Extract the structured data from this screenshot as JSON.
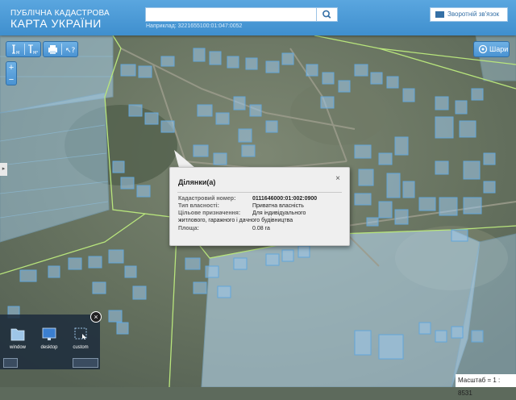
{
  "header": {
    "title_line1": "ПУБЛІЧНА КАДАСТРОВА",
    "title_line2": "КАРТА УКРАЇНИ",
    "search_placeholder": "",
    "search_hint": "Наприклад: 3221655100:01:047:0052",
    "feedback_label": "Зворотній зв'язок"
  },
  "toolbar": {
    "left_tools": [
      "measure-length",
      "measure-area",
      "print",
      "help"
    ],
    "zoom_in": "+",
    "zoom_out": "−",
    "layers_label": "Шари"
  },
  "popup": {
    "title": "Ділянки(а)",
    "close": "×",
    "rows": [
      {
        "label": "Кадастровий номер:",
        "value": "0111646000:01:002:0900"
      },
      {
        "label": "Тип власності:",
        "value": "Приватна власність"
      },
      {
        "label": "Цільове призначення:",
        "value": "Для індивідуального житлового, гаражного і дачного будівництва"
      },
      {
        "label": "Площа:",
        "value": "0.08 га"
      }
    ]
  },
  "dock": {
    "items": [
      {
        "label": "window",
        "icon": "folder-icon"
      },
      {
        "label": "desktop",
        "icon": "monitor-icon"
      },
      {
        "label": "custom",
        "icon": "region-select-icon"
      }
    ],
    "close": "×"
  },
  "scale": {
    "label": "Масштаб = 1 : 8531"
  },
  "colors": {
    "header": "#4b9ad8",
    "parcel_fill": "#9cc6ea",
    "parcel_stroke": "#5ea3d8",
    "boundary": "#b5e07a"
  }
}
